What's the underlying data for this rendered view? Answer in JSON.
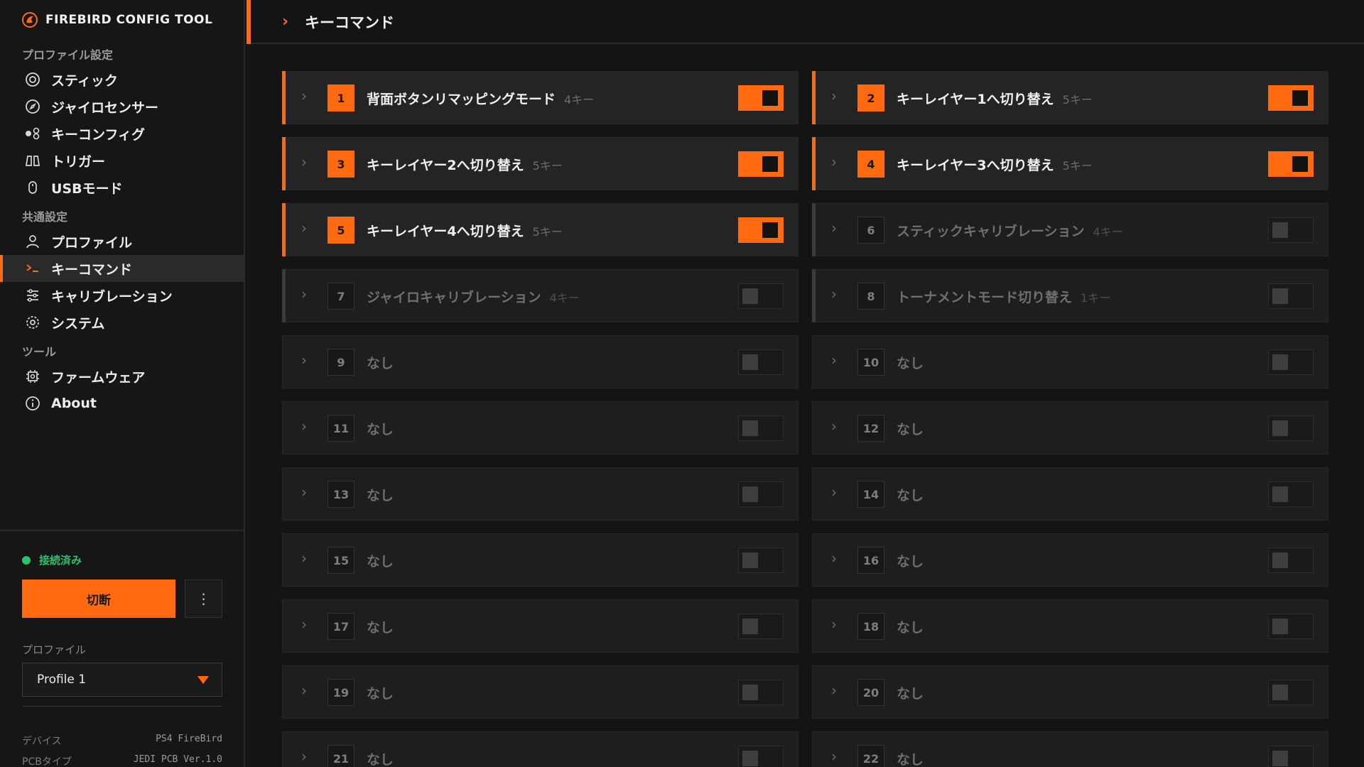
{
  "app": {
    "title": "FIREBIRD CONFIG TOOL",
    "accent_color": "#ff6a10",
    "connected_color": "#27c26a"
  },
  "sidebar": {
    "sections": [
      {
        "label": "プロファイル設定",
        "items": [
          {
            "label": "スティック",
            "icon": "stick-icon"
          },
          {
            "label": "ジャイロセンサー",
            "icon": "compass-icon"
          },
          {
            "label": "キーコンフィグ",
            "icon": "gamepad-icon"
          },
          {
            "label": "トリガー",
            "icon": "trigger-icon"
          },
          {
            "label": "USBモード",
            "icon": "mouse-icon"
          }
        ]
      },
      {
        "label": "共通設定",
        "items": [
          {
            "label": "プロファイル",
            "icon": "user-icon"
          },
          {
            "label": "キーコマンド",
            "icon": "terminal-icon"
          },
          {
            "label": "キャリブレーション",
            "icon": "sliders-icon"
          },
          {
            "label": "システム",
            "icon": "gear-icon"
          }
        ]
      },
      {
        "label": "ツール",
        "items": [
          {
            "label": "ファームウェア",
            "icon": "chip-icon"
          },
          {
            "label": "About",
            "icon": "info-icon"
          }
        ]
      }
    ],
    "active_item": "キーコマンド",
    "status": "接続済み",
    "disconnect_label": "切断",
    "more_icon": "more-vertical-icon",
    "profile_label": "プロファイル",
    "profile_value": "Profile 1",
    "device_info": [
      {
        "label": "デバイス",
        "value": "PS4 FireBird"
      },
      {
        "label": "PCBタイプ",
        "value": "JEDI PCB Ver.1.0"
      }
    ]
  },
  "header": {
    "title": "キーコマンド"
  },
  "commands": [
    {
      "num": "1",
      "name": "背面ボタンリマッピングモード",
      "keys": "4キー",
      "enabled": true,
      "set": true
    },
    {
      "num": "2",
      "name": "キーレイヤー1へ切り替え",
      "keys": "5キー",
      "enabled": true,
      "set": true
    },
    {
      "num": "3",
      "name": "キーレイヤー2へ切り替え",
      "keys": "5キー",
      "enabled": true,
      "set": true
    },
    {
      "num": "4",
      "name": "キーレイヤー3へ切り替え",
      "keys": "5キー",
      "enabled": true,
      "set": true
    },
    {
      "num": "5",
      "name": "キーレイヤー4へ切り替え",
      "keys": "5キー",
      "enabled": true,
      "set": true
    },
    {
      "num": "6",
      "name": "スティックキャリブレーション",
      "keys": "4キー",
      "enabled": false,
      "set": true
    },
    {
      "num": "7",
      "name": "ジャイロキャリブレーション",
      "keys": "4キー",
      "enabled": false,
      "set": true
    },
    {
      "num": "8",
      "name": "トーナメントモード切り替え",
      "keys": "1キー",
      "enabled": false,
      "set": true
    },
    {
      "num": "9",
      "name": "なし",
      "keys": "",
      "enabled": false,
      "set": false
    },
    {
      "num": "10",
      "name": "なし",
      "keys": "",
      "enabled": false,
      "set": false
    },
    {
      "num": "11",
      "name": "なし",
      "keys": "",
      "enabled": false,
      "set": false
    },
    {
      "num": "12",
      "name": "なし",
      "keys": "",
      "enabled": false,
      "set": false
    },
    {
      "num": "13",
      "name": "なし",
      "keys": "",
      "enabled": false,
      "set": false
    },
    {
      "num": "14",
      "name": "なし",
      "keys": "",
      "enabled": false,
      "set": false
    },
    {
      "num": "15",
      "name": "なし",
      "keys": "",
      "enabled": false,
      "set": false
    },
    {
      "num": "16",
      "name": "なし",
      "keys": "",
      "enabled": false,
      "set": false
    },
    {
      "num": "17",
      "name": "なし",
      "keys": "",
      "enabled": false,
      "set": false
    },
    {
      "num": "18",
      "name": "なし",
      "keys": "",
      "enabled": false,
      "set": false
    },
    {
      "num": "19",
      "name": "なし",
      "keys": "",
      "enabled": false,
      "set": false
    },
    {
      "num": "20",
      "name": "なし",
      "keys": "",
      "enabled": false,
      "set": false
    },
    {
      "num": "21",
      "name": "なし",
      "keys": "",
      "enabled": false,
      "set": false
    },
    {
      "num": "22",
      "name": "なし",
      "keys": "",
      "enabled": false,
      "set": false
    }
  ]
}
